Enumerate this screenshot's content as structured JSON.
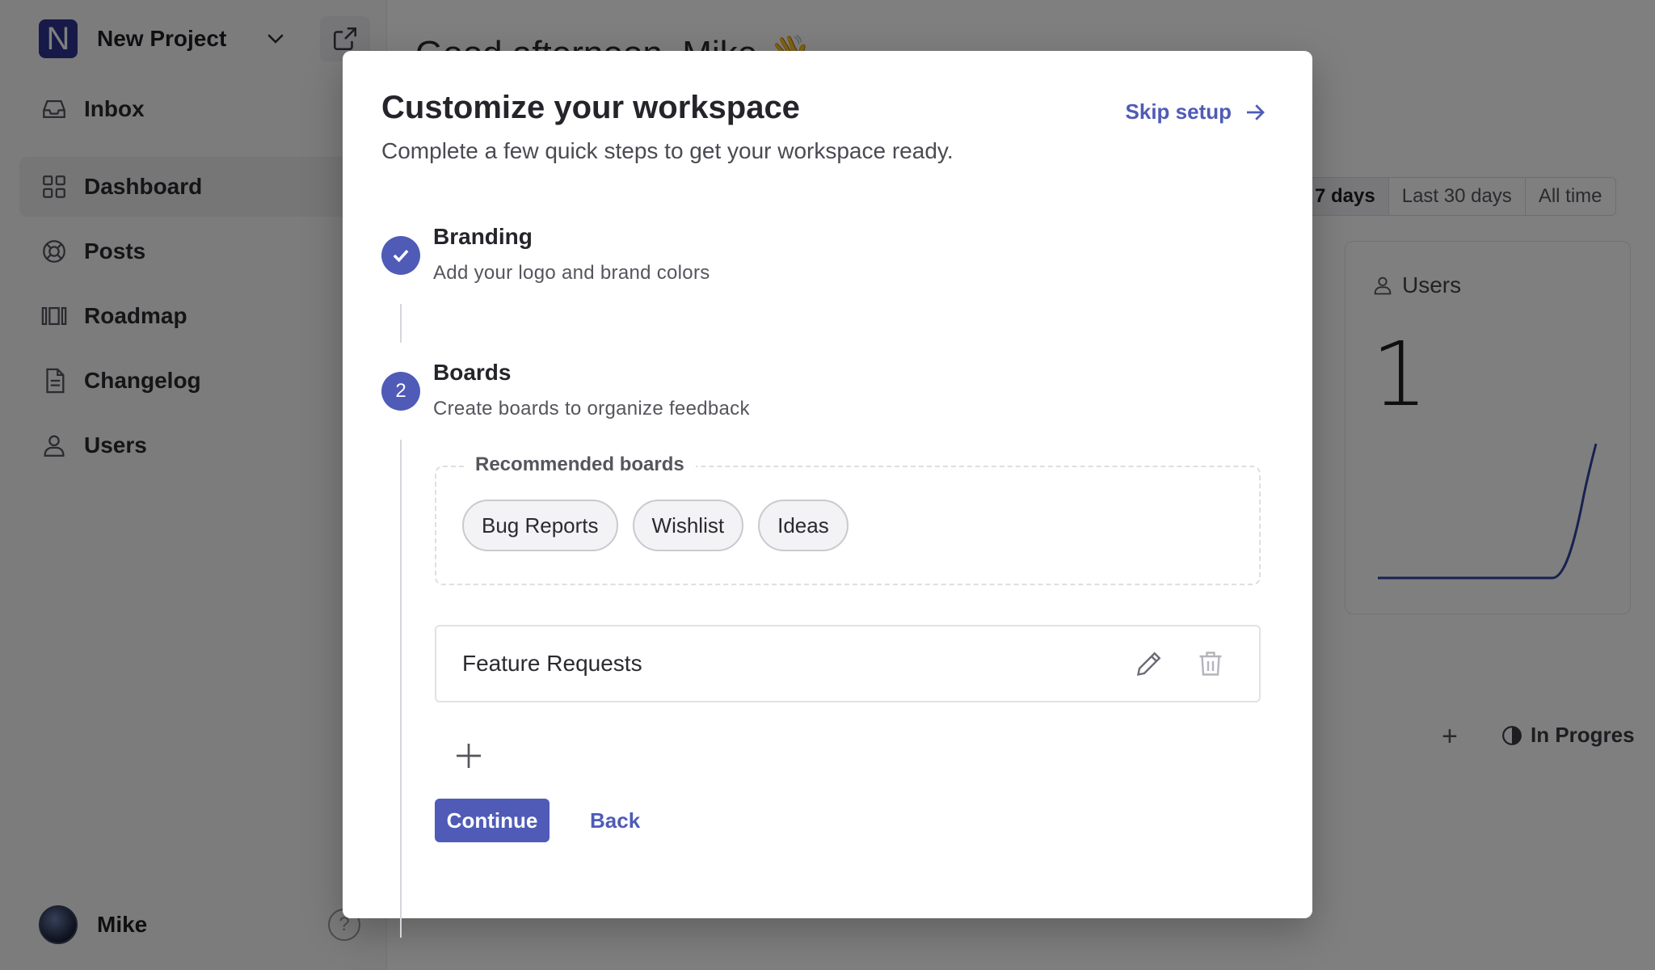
{
  "sidebar": {
    "project_initial": "N",
    "project_name": "New Project",
    "nav": [
      {
        "label": "Inbox",
        "icon": "inbox-icon"
      },
      {
        "label": "Dashboard",
        "icon": "dashboard-icon",
        "active": true
      },
      {
        "label": "Posts",
        "icon": "posts-icon"
      },
      {
        "label": "Roadmap",
        "icon": "roadmap-icon"
      },
      {
        "label": "Changelog",
        "icon": "changelog-icon"
      },
      {
        "label": "Users",
        "icon": "users-icon"
      }
    ],
    "user_name": "Mike",
    "help_glyph": "?"
  },
  "main": {
    "greeting": "Good afternoon, Mike 👋",
    "range_tabs": [
      "7 days",
      "Last 30 days",
      "All time"
    ],
    "stat": {
      "label": "Users",
      "value": "1"
    },
    "add_glyph": "+",
    "status_label": "In Progres"
  },
  "modal": {
    "title": "Customize your workspace",
    "subtitle": "Complete a few quick steps to get your workspace ready.",
    "skip_label": "Skip setup",
    "steps": [
      {
        "title": "Branding",
        "description": "Add your logo and brand colors",
        "status": "complete"
      },
      {
        "number": "2",
        "title": "Boards",
        "description": "Create boards to organize feedback",
        "status": "current"
      }
    ],
    "recommended_label": "Recommended boards",
    "recommended": [
      "Bug Reports",
      "Wishlist",
      "Ideas"
    ],
    "boards": [
      {
        "name": "Feature Requests"
      }
    ],
    "continue_label": "Continue",
    "back_label": "Back"
  },
  "colors": {
    "accent": "#4f5bb7",
    "brand": "#2e3491",
    "overlay": "rgba(0,0,0,0.5)"
  }
}
